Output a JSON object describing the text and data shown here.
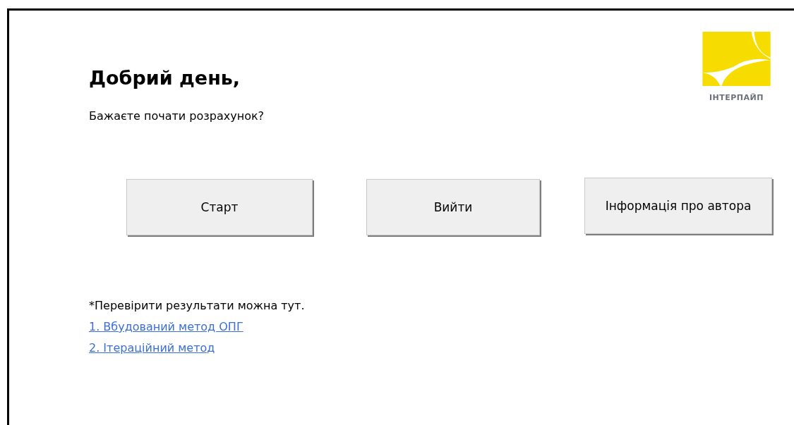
{
  "greeting": "Добрий день,",
  "prompt": "Бажаєте почати розрахунок?",
  "logo": {
    "text": "ІНТЕРПАЙП"
  },
  "buttons": [
    "Старт",
    "Вийти",
    "Інформація про автора"
  ],
  "note": "*Перевірити результати можна тут.",
  "links": [
    "1. Вбудований метод ОПГ",
    "2. Ітераційний метод"
  ]
}
